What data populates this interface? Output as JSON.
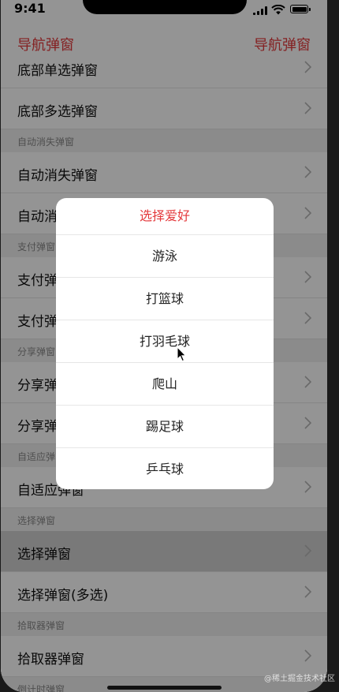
{
  "status_bar": {
    "time": "9:41"
  },
  "nav": {
    "left_label": "导航弹窗",
    "right_label": "导航弹窗"
  },
  "list": {
    "r1": "底部单选弹窗",
    "r2": "底部多选弹窗",
    "s1": "自动消失弹窗",
    "r3": "自动消失弹窗",
    "r4": "自动消失弹窗",
    "s2": "支付弹窗",
    "r5": "支付弹窗",
    "r6": "支付弹窗",
    "s3": "分享弹窗",
    "r7": "分享弹窗",
    "r8": "分享弹窗",
    "s4": "自适应弹窗",
    "r9": "自适应弹窗",
    "s5": "选择弹窗",
    "r10": "选择弹窗",
    "r11": "选择弹窗(多选)",
    "s6": "拾取器弹窗",
    "r12": "拾取器弹窗",
    "s7": "倒计时弹窗"
  },
  "dialog": {
    "title": "选择爱好",
    "options": [
      "游泳",
      "打篮球",
      "打羽毛球",
      "爬山",
      "踢足球",
      "乒乓球"
    ]
  },
  "watermark": "@稀土掘金技术社区",
  "colors": {
    "accent": "#e4393c",
    "section_bg": "#efefef",
    "overlay": "rgba(0,0,0,0.42)"
  },
  "icons": {
    "row_chevron": "chevron-right-icon",
    "cursor": "mouse-cursor-icon"
  }
}
